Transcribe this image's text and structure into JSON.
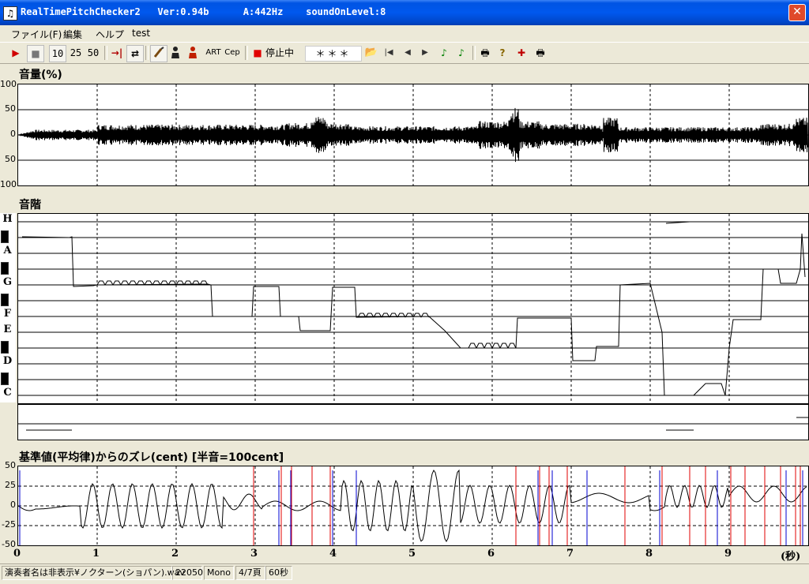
{
  "window": {
    "title": "RealTimePitchChecker2   Ver:0.94b      A:442Hz    soundOnLevel:8",
    "close": "✕",
    "icon": "♫"
  },
  "menu": [
    "ファイル(F)",
    "編集",
    "ヘルプ",
    "test"
  ],
  "toolbar": {
    "play": "▶",
    "stop": "■",
    "zoom10": "10",
    "zoom25": "25",
    "zoom50": "50",
    "jump": "→|",
    "loop": "⇄",
    "art": "ART",
    "cep": "Cep",
    "rec": "■",
    "status": "停止中",
    "note": "＊＊＊",
    "open": "📂",
    "first": "|◀",
    "prev": "◀",
    "next": "▶",
    "note1": "♪",
    "note2": "♪",
    "print": "🖶",
    "help": "?",
    "mark": "✚",
    "print2": "🖶"
  },
  "volume": {
    "label": "音量(%)",
    "ticks": [
      "100",
      "50",
      "0",
      "50",
      "100"
    ]
  },
  "scale": {
    "label": "音階",
    "notes": [
      "H",
      "A",
      "G",
      "F",
      "E",
      "D",
      "C"
    ]
  },
  "deviation": {
    "label": "基準値(平均律)からのズレ(cent) [半音=100cent]",
    "ticks": [
      "50",
      "25",
      "0",
      "-25",
      "-50"
    ]
  },
  "time_axis": {
    "ticks": [
      "0",
      "1",
      "2",
      "3",
      "4",
      "5",
      "6",
      "7",
      "8",
      "9"
    ],
    "unit": "(秒)"
  },
  "statusbar": [
    "演奏者名は非表示¥ノクターン(ショパン).wav",
    "22050",
    "Mono",
    "4/7頁",
    "60秒"
  ],
  "colors": {
    "titlebar": "#0054e3",
    "red_line": "#e00000",
    "blue_line": "#0000d0"
  }
}
